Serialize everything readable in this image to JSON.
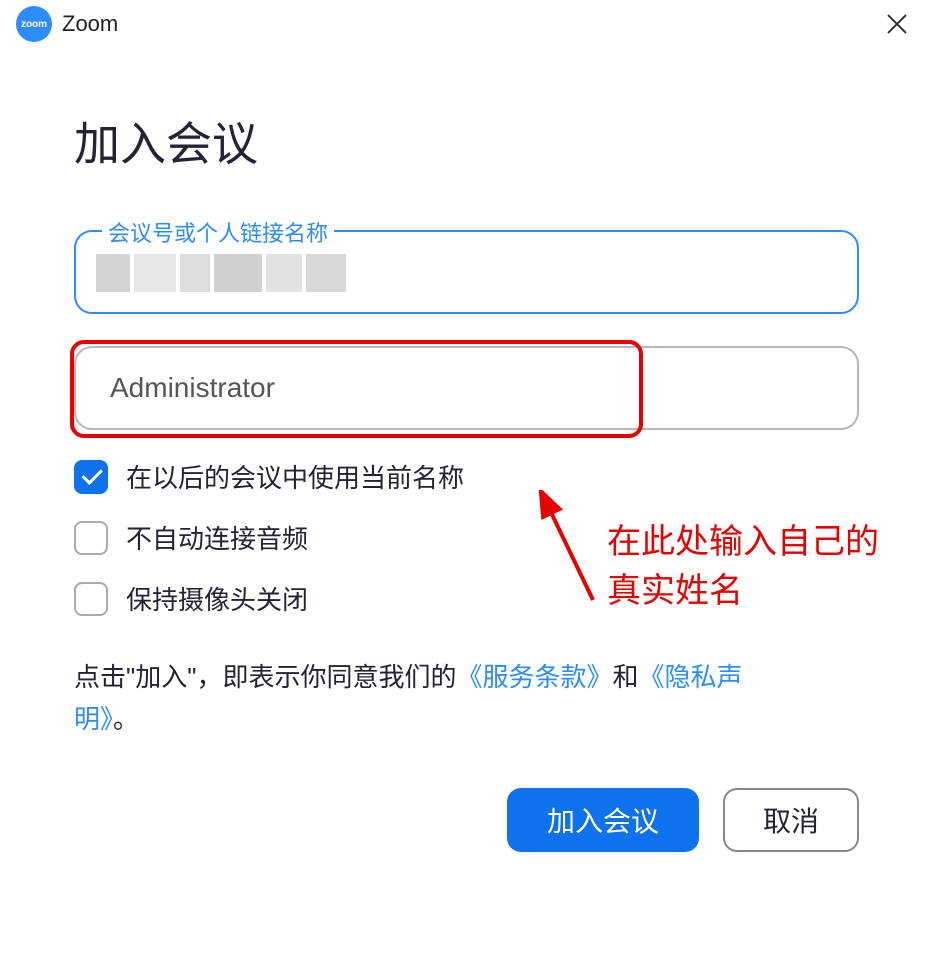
{
  "titlebar": {
    "app_name": "Zoom",
    "logo_text": "zoom"
  },
  "dialog": {
    "title": "加入会议",
    "meeting_id": {
      "label": "会议号或个人链接名称",
      "value": ""
    },
    "name_field": {
      "value": "Administrator"
    },
    "checkboxes": [
      {
        "label": "在以后的会议中使用当前名称",
        "checked": true
      },
      {
        "label": "不自动连接音频",
        "checked": false
      },
      {
        "label": "保持摄像头关闭",
        "checked": false
      }
    ],
    "annotation": {
      "line1": "在此处输入自己的",
      "line2": "真实姓名"
    },
    "terms": {
      "prefix": "点击\"加入\"，即表示你同意我们的",
      "tos": "《服务条款》",
      "conjunction": "和",
      "privacy_start": "《隐私声",
      "privacy_end": "明》",
      "suffix": "。"
    },
    "buttons": {
      "join": "加入会议",
      "cancel": "取消"
    }
  },
  "colors": {
    "primary": "#0E72ED",
    "accent_border": "#2D8CFF",
    "annotation_red": "#e60000"
  }
}
